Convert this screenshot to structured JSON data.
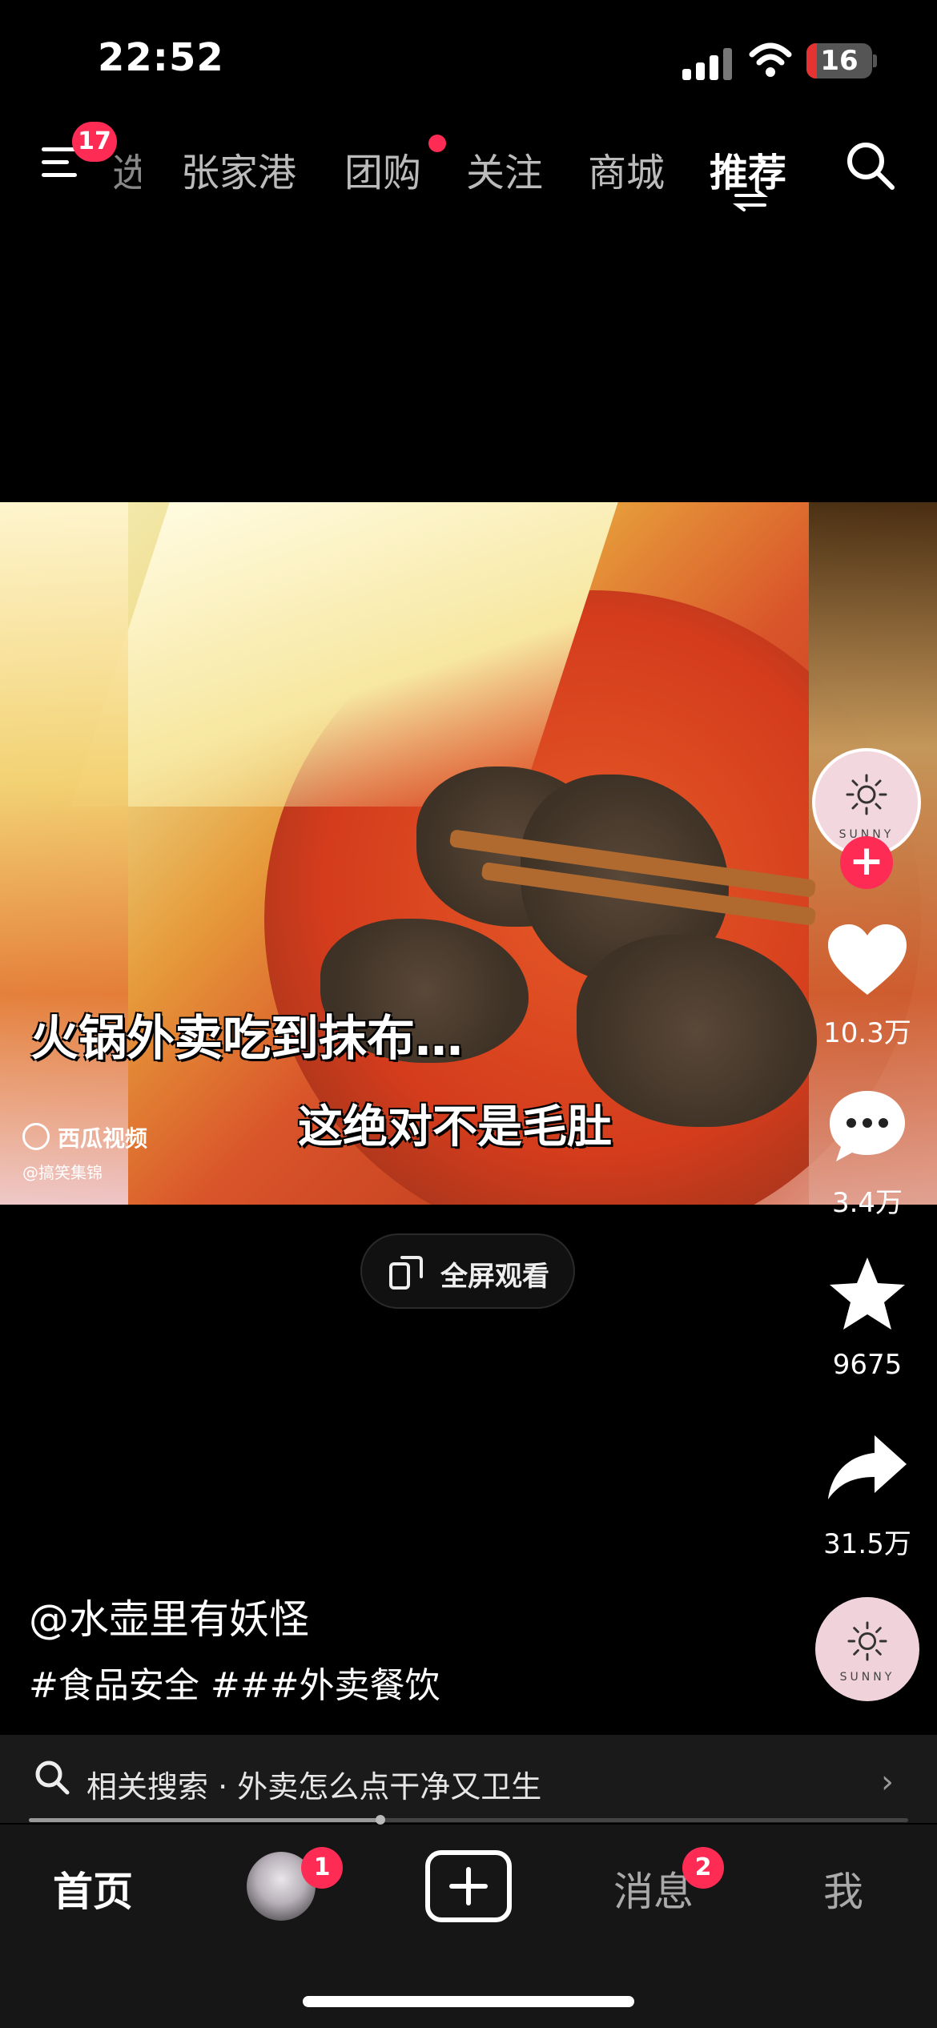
{
  "status_bar": {
    "time": "22:52",
    "battery": "16",
    "battery_level": 0.16
  },
  "top_nav": {
    "menu_badge": "17",
    "partial_tab": "选",
    "tabs": [
      "张家港",
      "团购",
      "关注",
      "商城",
      "推荐"
    ],
    "active_tab": "推荐"
  },
  "video": {
    "caption_main": "火锅外卖吃到抹布…",
    "caption_sub": "这绝对不是毛肚",
    "watermark_brand": "西瓜视频",
    "watermark_account": "@搞笑集锦"
  },
  "fullscreen_button": {
    "label": "全屏观看"
  },
  "right_rail": {
    "avatar_text": "SUNNY",
    "likes": "10.3万",
    "comments": "3.4万",
    "favorites": "9675",
    "shares": "31.5万",
    "music_avatar_text": "SUNNY"
  },
  "post": {
    "author": "@水壶里有妖怪",
    "tags": "#食品安全 ###外卖餐饮"
  },
  "related_search": {
    "text": "相关搜索 · 外卖怎么点干净又卫生",
    "progress": 0.4
  },
  "tab_bar": {
    "home": "首页",
    "friends_badge": "1",
    "messages": "消息",
    "messages_badge": "2",
    "me": "我"
  },
  "colors": {
    "accent": "#fe2c55",
    "background": "#000000",
    "tabbar": "#161616"
  }
}
